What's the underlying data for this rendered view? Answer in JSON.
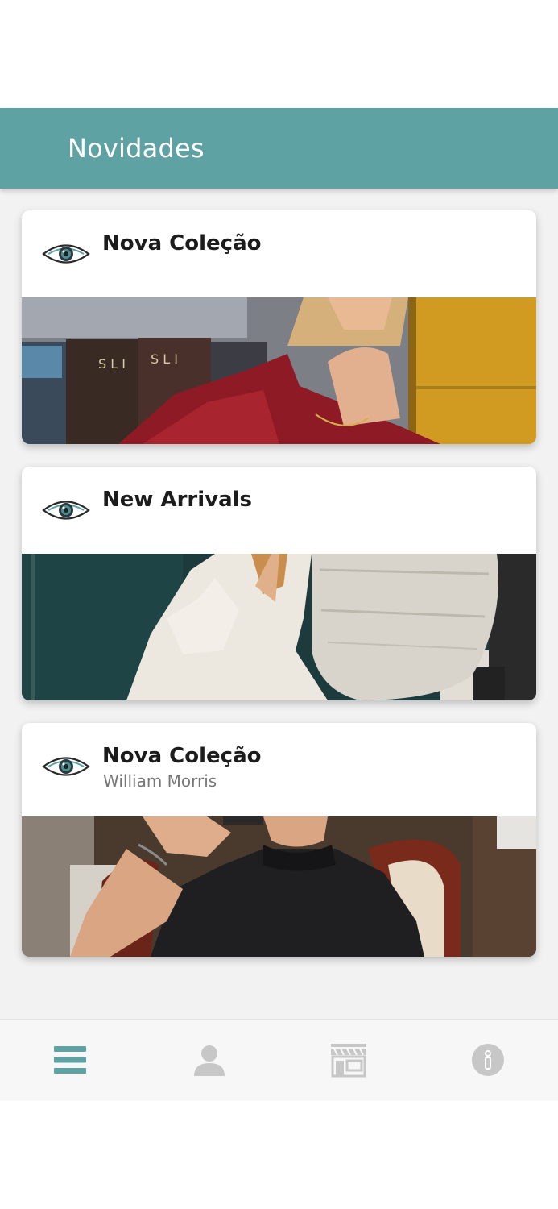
{
  "header": {
    "title": "Novidades"
  },
  "colors": {
    "accent": "#5fa2a4",
    "nav_active": "#5fa2a4",
    "nav_inactive": "#c7c7c7"
  },
  "cards": [
    {
      "title": "Nova Coleção",
      "subtitle": "",
      "icon": "eye-icon"
    },
    {
      "title": "New Arrivals",
      "subtitle": "",
      "icon": "eye-icon"
    },
    {
      "title": "Nova Coleção",
      "subtitle": "William Morris",
      "icon": "eye-icon"
    }
  ],
  "bottom_nav": {
    "items": [
      {
        "icon": "menu-icon",
        "active": true
      },
      {
        "icon": "user-icon",
        "active": false
      },
      {
        "icon": "store-icon",
        "active": false
      },
      {
        "icon": "info-icon",
        "active": false
      }
    ]
  }
}
